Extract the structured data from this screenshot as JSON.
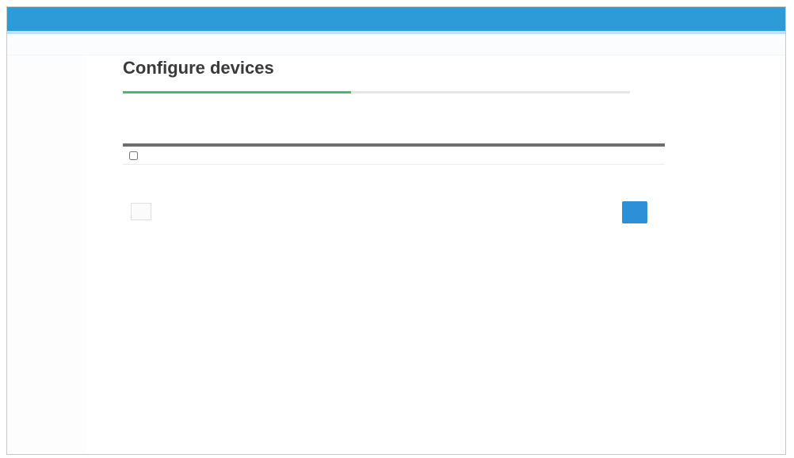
{
  "window": {
    "title": "",
    "accent_color": "#2d9bd8"
  },
  "page": {
    "title": "Configure devices",
    "instruction": "",
    "progress": 0.45,
    "progress_color": "#3fbf6a"
  },
  "table": {
    "add_label": "",
    "columns": [
      "",
      "",
      "",
      ""
    ],
    "rows": [
      [
        "",
        "",
        "",
        ""
      ]
    ]
  },
  "footnote": {
    "text": "",
    "link": ""
  },
  "buttons": {
    "back_label": "",
    "next_label": ""
  }
}
